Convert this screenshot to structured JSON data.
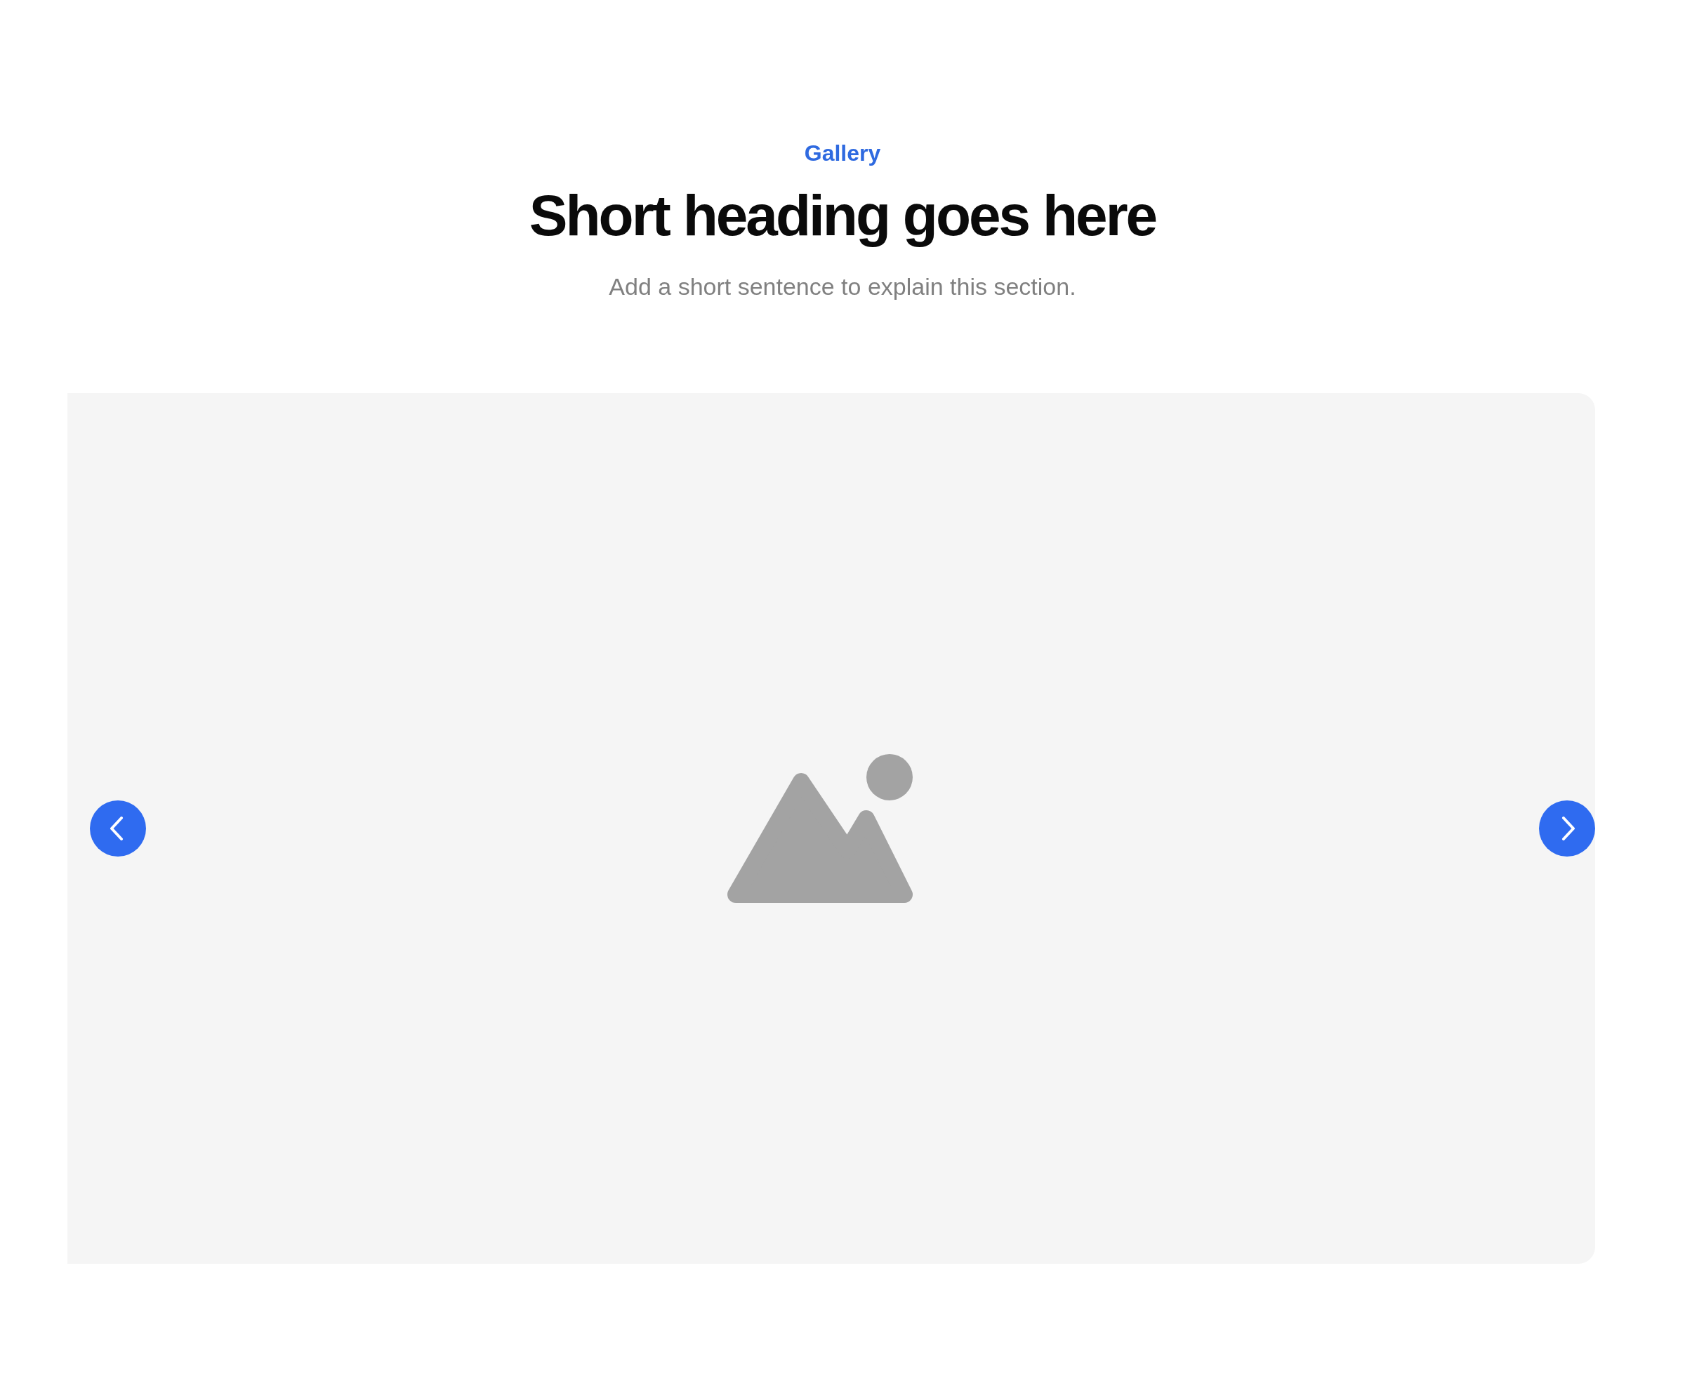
{
  "header": {
    "eyebrow": "Gallery",
    "heading": "Short heading goes here",
    "description": "Add a short sentence to explain this section."
  },
  "carousel": {
    "controls": [
      {
        "kind": "previous"
      },
      {
        "kind": "next"
      }
    ]
  }
}
